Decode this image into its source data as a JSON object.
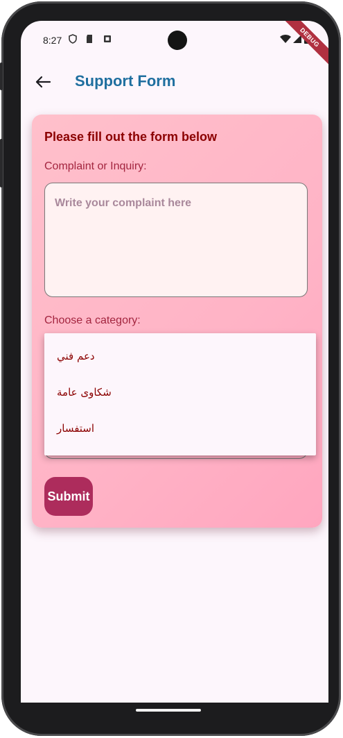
{
  "status_bar": {
    "time": "8:27",
    "debug_banner": "DEBUG"
  },
  "app_bar": {
    "title": "Support Form"
  },
  "form": {
    "heading": "Please fill out the form below",
    "complaint_label": "Complaint or Inquiry:",
    "complaint_placeholder": "Write your complaint here",
    "complaint_value": "",
    "category_label": "Choose a category:",
    "category_options": [
      "دعم فني",
      "شكاوى عامة",
      "استفسار"
    ],
    "submit_label": "Submit"
  },
  "colors": {
    "app_title": "#1f6f9f",
    "heading": "#8b0000",
    "label": "#a3253f",
    "card_gradient_start": "#ffc0cb",
    "submit_bg": "#ad2c5c"
  }
}
